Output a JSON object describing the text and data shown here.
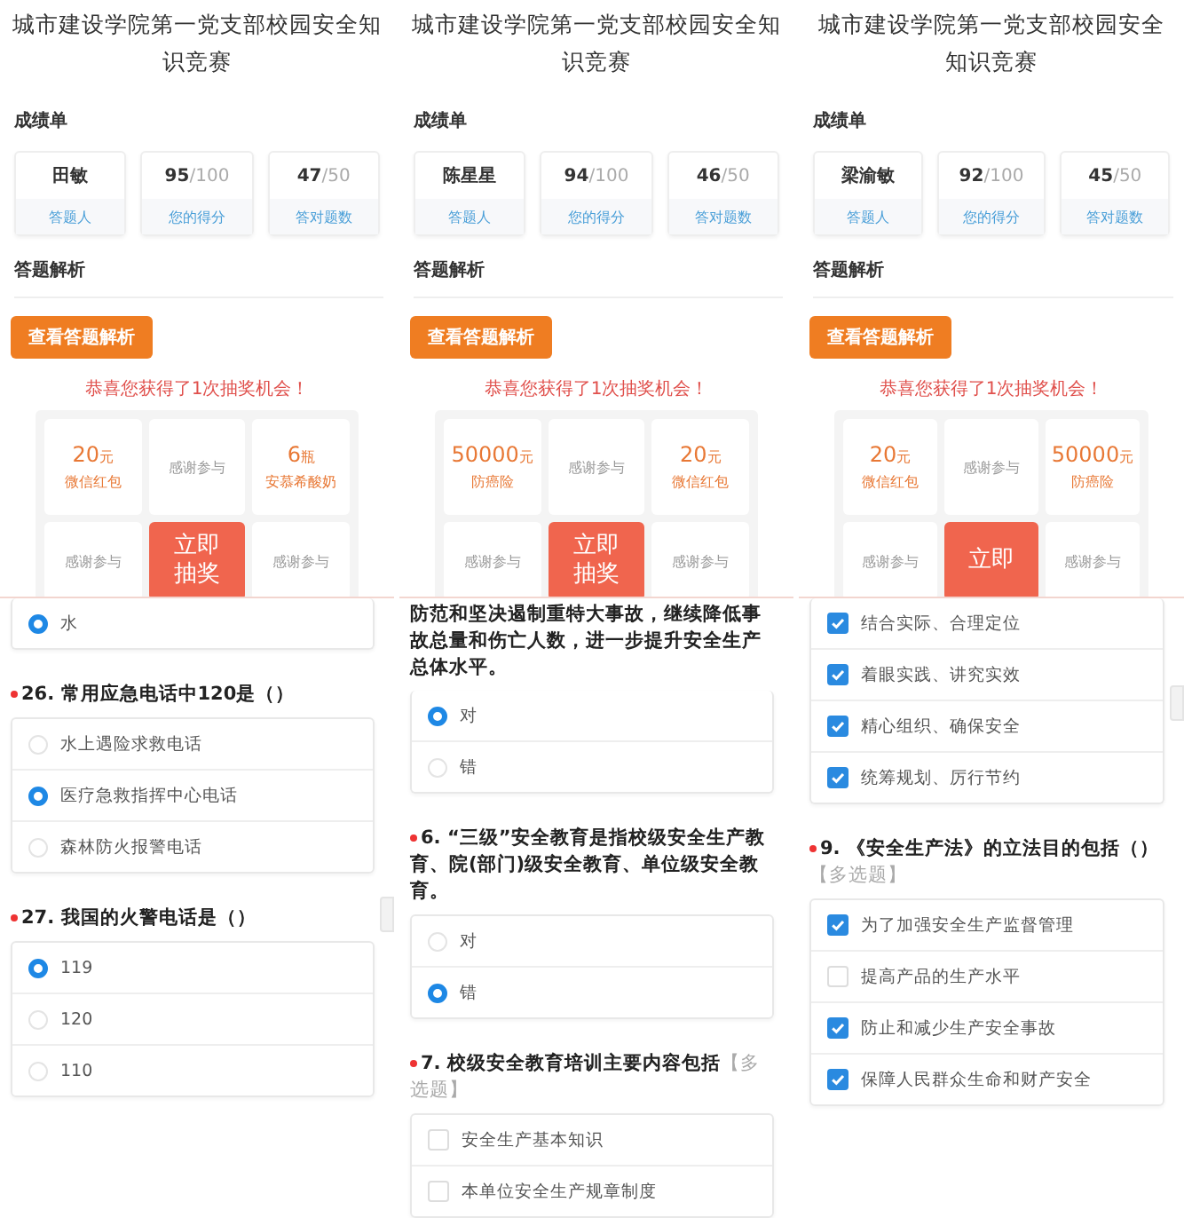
{
  "panels": [
    {
      "title": "城市建设学院第一党支部校园安全知识竞赛",
      "score_heading": "成绩单",
      "score_cards": [
        {
          "value": "田敏",
          "label": "答题人"
        },
        {
          "value": "95",
          "total": "/100",
          "label": "您的得分"
        },
        {
          "value": "47",
          "total": "/50",
          "label": "答对题数"
        }
      ],
      "analysis_heading": "答题解析",
      "analysis_button": "查看答题解析",
      "congrats": "恭喜您获得了1次抽奖机会！",
      "prizes": [
        {
          "kind": "prize",
          "amount": "20",
          "unit": "元",
          "name": "微信红包"
        },
        {
          "kind": "thanks",
          "text": "感谢参与"
        },
        {
          "kind": "prize",
          "amount": "6",
          "unit": "瓶",
          "name": "安慕希酸奶"
        }
      ],
      "bottom_prizes": [
        "感谢参与",
        "感谢参与"
      ],
      "draw_button": "立即抽奖",
      "scroll_handle": true,
      "questions": [
        {
          "kind": "radio",
          "options": [
            {
              "label": "水",
              "selected": true
            }
          ]
        },
        {
          "kind": "radio",
          "required": true,
          "number": "26.",
          "text": "常用应急电话中120是（）",
          "options": [
            {
              "label": "水上遇险求救电话",
              "selected": false
            },
            {
              "label": "医疗急救指挥中心电话",
              "selected": true
            },
            {
              "label": "森林防火报警电话",
              "selected": false
            }
          ]
        },
        {
          "kind": "radio",
          "required": true,
          "number": "27.",
          "text": "我国的火警电话是（）",
          "options": [
            {
              "label": "119",
              "selected": true
            },
            {
              "label": "120",
              "selected": false
            },
            {
              "label": "110",
              "selected": false
            }
          ]
        }
      ]
    },
    {
      "title": "城市建设学院第一党支部校园安全知识竞赛",
      "score_heading": "成绩单",
      "score_cards": [
        {
          "value": "陈星星",
          "label": "答题人"
        },
        {
          "value": "94",
          "total": "/100",
          "label": "您的得分"
        },
        {
          "value": "46",
          "total": "/50",
          "label": "答对题数"
        }
      ],
      "analysis_heading": "答题解析",
      "analysis_button": "查看答题解析",
      "congrats": "恭喜您获得了1次抽奖机会！",
      "prizes": [
        {
          "kind": "prize",
          "amount": "50000",
          "unit": "元",
          "name": "防癌险"
        },
        {
          "kind": "thanks",
          "text": "感谢参与"
        },
        {
          "kind": "prize",
          "amount": "20",
          "unit": "元",
          "name": "微信红包"
        }
      ],
      "bottom_prizes": [
        "感谢参与",
        "感谢参与"
      ],
      "draw_button": "立即抽奖",
      "questions": [
        {
          "kind": "radio",
          "text": "防范和坚决遏制重特大事故，继续降低事故总量和伤亡人数，进一步提升安全生产总体水平。",
          "options": [
            {
              "label": "对",
              "selected": true
            },
            {
              "label": "错",
              "selected": false
            }
          ]
        },
        {
          "kind": "radio",
          "required": true,
          "number": "6.",
          "text": "“三级”安全教育是指校级安全生产教育、院(部门)级安全教育、单位级安全教育。",
          "options": [
            {
              "label": "对",
              "selected": false
            },
            {
              "label": "错",
              "selected": true
            }
          ]
        },
        {
          "kind": "checkbox",
          "required": true,
          "number": "7.",
          "text": "校级安全教育培训主要内容包括",
          "tag": "【多选题】",
          "options": [
            {
              "label": "安全生产基本知识",
              "checked": false
            },
            {
              "label": "本单位安全生产规章制度",
              "checked": false
            }
          ]
        }
      ]
    },
    {
      "title": "城市建设学院第一党支部校园安全知识竞赛",
      "score_heading": "成绩单",
      "score_cards": [
        {
          "value": "梁渝敏",
          "label": "答题人"
        },
        {
          "value": "92",
          "total": "/100",
          "label": "您的得分"
        },
        {
          "value": "45",
          "total": "/50",
          "label": "答对题数"
        }
      ],
      "analysis_heading": "答题解析",
      "analysis_button": "查看答题解析",
      "congrats": "恭喜您获得了1次抽奖机会！",
      "prizes": [
        {
          "kind": "prize",
          "amount": "20",
          "unit": "元",
          "name": "微信红包"
        },
        {
          "kind": "thanks",
          "text": "感谢参与"
        },
        {
          "kind": "prize",
          "amount": "50000",
          "unit": "元",
          "name": "防癌险"
        }
      ],
      "bottom_prizes": [
        "感谢参与",
        "感谢参与"
      ],
      "draw_button": "立即",
      "scroll_handle": true,
      "questions": [
        {
          "kind": "checkbox",
          "options": [
            {
              "label": "结合实际、合理定位",
              "checked": true
            },
            {
              "label": "着眼实践、讲究实效",
              "checked": true
            },
            {
              "label": "精心组织、确保安全",
              "checked": true
            },
            {
              "label": "统筹规划、厉行节约",
              "checked": true
            }
          ]
        },
        {
          "kind": "checkbox",
          "required": true,
          "number": "9.",
          "text": "《安全生产法》的立法目的包括（）",
          "tag": "【多选题】",
          "options": [
            {
              "label": "为了加强安全生产监督管理",
              "checked": true
            },
            {
              "label": "提高产品的生产水平",
              "checked": false
            },
            {
              "label": "防止和减少生产安全事故",
              "checked": true
            },
            {
              "label": "保障人民群众生命和财产安全",
              "checked": true
            }
          ]
        }
      ]
    }
  ]
}
